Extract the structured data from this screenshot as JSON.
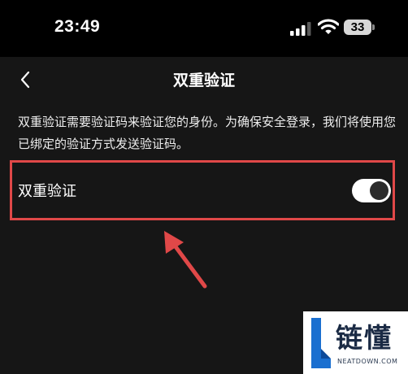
{
  "status_bar": {
    "time": "23:49",
    "battery_level": "33",
    "signal_icon": "cellular-signal-icon",
    "wifi_icon": "wifi-icon"
  },
  "nav": {
    "back_icon": "chevron-left-icon",
    "title": "双重验证"
  },
  "description": "双重验证需要验证码来验证您的身份。为确保安全登录，我们将使用您已绑定的验证方式发送验证码。",
  "setting": {
    "label": "双重验证",
    "toggle_on": true
  },
  "annotation": {
    "highlight_color": "#e04848",
    "arrow_color": "#e04848"
  },
  "watermark": {
    "title": "链懂",
    "subtitle": "NEATDOWN.COM",
    "logo_color": "#1a6fd0"
  }
}
